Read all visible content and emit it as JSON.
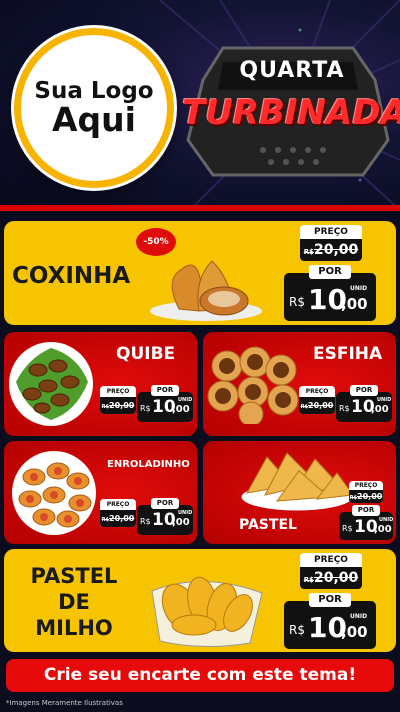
{
  "logo": {
    "line1": "Sua Logo",
    "line2": "Aqui"
  },
  "badge": {
    "line1": "QUARTA",
    "line2": "TURBINADA"
  },
  "currency": "R$",
  "common": {
    "preco_label": "PREÇO",
    "por_label": "POR",
    "unid_label": "UNID",
    "old_price": "20,00"
  },
  "products": [
    {
      "name": "COXINHA",
      "discount": "-50%",
      "old_price": "20,00",
      "new_price_int": "10",
      "new_price_cents": ",00"
    },
    {
      "name": "QUIBE",
      "old_price": "20,00",
      "new_price_int": "10",
      "new_price_cents": ",00"
    },
    {
      "name": "ESFIHA",
      "old_price": "20,00",
      "new_price_int": "10",
      "new_price_cents": ",00"
    },
    {
      "name": "ENROLADINHO",
      "old_price": "20,00",
      "new_price_int": "10",
      "new_price_cents": ",00"
    },
    {
      "name": "PASTEL",
      "old_price": "20,00",
      "new_price_int": "10",
      "new_price_cents": ",00"
    },
    {
      "name_lines": [
        "PASTEL",
        "DE",
        "MILHO"
      ],
      "old_price": "20,00",
      "new_price_int": "10",
      "new_price_cents": ",00"
    }
  ],
  "cta": "Crie seu encarte com este tema!",
  "footnote": "*Imagens Meramente Ilustrativas",
  "colors": {
    "yellow": "#f6c400",
    "red": "#e00b0b",
    "dark": "#0b0d1e",
    "gold": "#f6b400"
  },
  "icons": [
    "coxinha-image",
    "quibe-image",
    "esfiha-image",
    "enroladinho-image",
    "pastel-image",
    "pastel-de-milho-image"
  ]
}
